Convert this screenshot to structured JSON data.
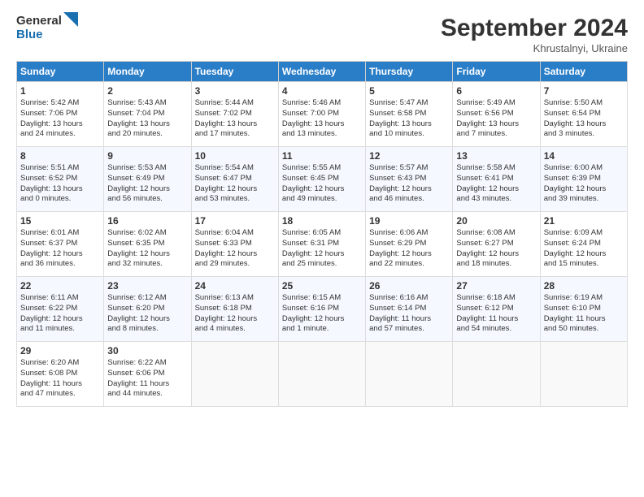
{
  "logo": {
    "line1": "General",
    "line2": "Blue"
  },
  "title": "September 2024",
  "subtitle": "Khrustalnyi, Ukraine",
  "weekdays": [
    "Sunday",
    "Monday",
    "Tuesday",
    "Wednesday",
    "Thursday",
    "Friday",
    "Saturday"
  ],
  "weeks": [
    [
      {
        "day": 1,
        "info": "Sunrise: 5:42 AM\nSunset: 7:06 PM\nDaylight: 13 hours\nand 24 minutes."
      },
      {
        "day": 2,
        "info": "Sunrise: 5:43 AM\nSunset: 7:04 PM\nDaylight: 13 hours\nand 20 minutes."
      },
      {
        "day": 3,
        "info": "Sunrise: 5:44 AM\nSunset: 7:02 PM\nDaylight: 13 hours\nand 17 minutes."
      },
      {
        "day": 4,
        "info": "Sunrise: 5:46 AM\nSunset: 7:00 PM\nDaylight: 13 hours\nand 13 minutes."
      },
      {
        "day": 5,
        "info": "Sunrise: 5:47 AM\nSunset: 6:58 PM\nDaylight: 13 hours\nand 10 minutes."
      },
      {
        "day": 6,
        "info": "Sunrise: 5:49 AM\nSunset: 6:56 PM\nDaylight: 13 hours\nand 7 minutes."
      },
      {
        "day": 7,
        "info": "Sunrise: 5:50 AM\nSunset: 6:54 PM\nDaylight: 13 hours\nand 3 minutes."
      }
    ],
    [
      {
        "day": 8,
        "info": "Sunrise: 5:51 AM\nSunset: 6:52 PM\nDaylight: 13 hours\nand 0 minutes."
      },
      {
        "day": 9,
        "info": "Sunrise: 5:53 AM\nSunset: 6:49 PM\nDaylight: 12 hours\nand 56 minutes."
      },
      {
        "day": 10,
        "info": "Sunrise: 5:54 AM\nSunset: 6:47 PM\nDaylight: 12 hours\nand 53 minutes."
      },
      {
        "day": 11,
        "info": "Sunrise: 5:55 AM\nSunset: 6:45 PM\nDaylight: 12 hours\nand 49 minutes."
      },
      {
        "day": 12,
        "info": "Sunrise: 5:57 AM\nSunset: 6:43 PM\nDaylight: 12 hours\nand 46 minutes."
      },
      {
        "day": 13,
        "info": "Sunrise: 5:58 AM\nSunset: 6:41 PM\nDaylight: 12 hours\nand 43 minutes."
      },
      {
        "day": 14,
        "info": "Sunrise: 6:00 AM\nSunset: 6:39 PM\nDaylight: 12 hours\nand 39 minutes."
      }
    ],
    [
      {
        "day": 15,
        "info": "Sunrise: 6:01 AM\nSunset: 6:37 PM\nDaylight: 12 hours\nand 36 minutes."
      },
      {
        "day": 16,
        "info": "Sunrise: 6:02 AM\nSunset: 6:35 PM\nDaylight: 12 hours\nand 32 minutes."
      },
      {
        "day": 17,
        "info": "Sunrise: 6:04 AM\nSunset: 6:33 PM\nDaylight: 12 hours\nand 29 minutes."
      },
      {
        "day": 18,
        "info": "Sunrise: 6:05 AM\nSunset: 6:31 PM\nDaylight: 12 hours\nand 25 minutes."
      },
      {
        "day": 19,
        "info": "Sunrise: 6:06 AM\nSunset: 6:29 PM\nDaylight: 12 hours\nand 22 minutes."
      },
      {
        "day": 20,
        "info": "Sunrise: 6:08 AM\nSunset: 6:27 PM\nDaylight: 12 hours\nand 18 minutes."
      },
      {
        "day": 21,
        "info": "Sunrise: 6:09 AM\nSunset: 6:24 PM\nDaylight: 12 hours\nand 15 minutes."
      }
    ],
    [
      {
        "day": 22,
        "info": "Sunrise: 6:11 AM\nSunset: 6:22 PM\nDaylight: 12 hours\nand 11 minutes."
      },
      {
        "day": 23,
        "info": "Sunrise: 6:12 AM\nSunset: 6:20 PM\nDaylight: 12 hours\nand 8 minutes."
      },
      {
        "day": 24,
        "info": "Sunrise: 6:13 AM\nSunset: 6:18 PM\nDaylight: 12 hours\nand 4 minutes."
      },
      {
        "day": 25,
        "info": "Sunrise: 6:15 AM\nSunset: 6:16 PM\nDaylight: 12 hours\nand 1 minute."
      },
      {
        "day": 26,
        "info": "Sunrise: 6:16 AM\nSunset: 6:14 PM\nDaylight: 11 hours\nand 57 minutes."
      },
      {
        "day": 27,
        "info": "Sunrise: 6:18 AM\nSunset: 6:12 PM\nDaylight: 11 hours\nand 54 minutes."
      },
      {
        "day": 28,
        "info": "Sunrise: 6:19 AM\nSunset: 6:10 PM\nDaylight: 11 hours\nand 50 minutes."
      }
    ],
    [
      {
        "day": 29,
        "info": "Sunrise: 6:20 AM\nSunset: 6:08 PM\nDaylight: 11 hours\nand 47 minutes."
      },
      {
        "day": 30,
        "info": "Sunrise: 6:22 AM\nSunset: 6:06 PM\nDaylight: 11 hours\nand 44 minutes."
      },
      {
        "day": null,
        "info": ""
      },
      {
        "day": null,
        "info": ""
      },
      {
        "day": null,
        "info": ""
      },
      {
        "day": null,
        "info": ""
      },
      {
        "day": null,
        "info": ""
      }
    ]
  ]
}
